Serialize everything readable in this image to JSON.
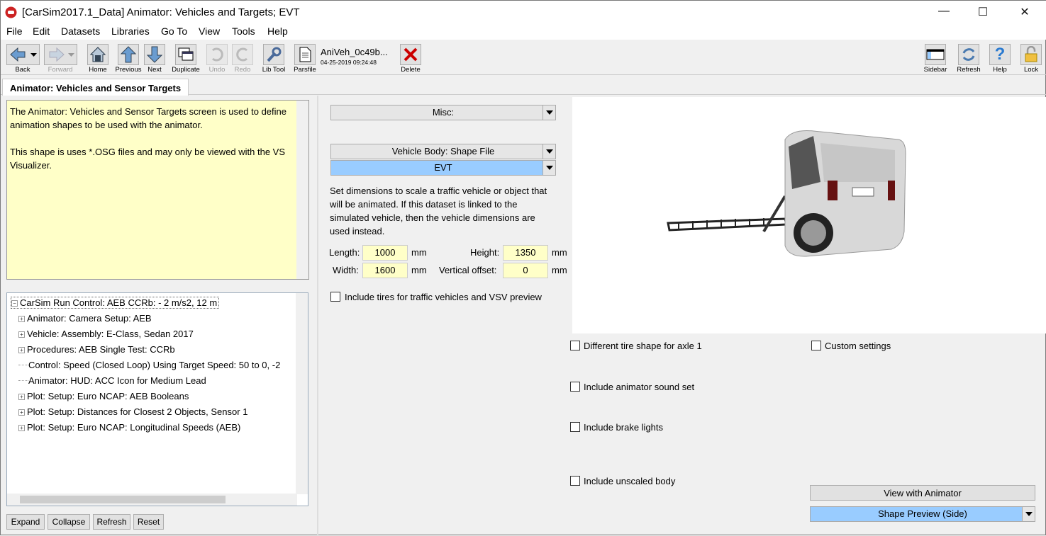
{
  "window": {
    "title": "[CarSim2017.1_Data] Animator: Vehicles and Targets; EVT",
    "minimize": "—",
    "maximize": "☐",
    "close": "✕"
  },
  "menu": [
    "File",
    "Edit",
    "Datasets",
    "Libraries",
    "Go To",
    "View",
    "Tools",
    "Help"
  ],
  "toolbar": {
    "back": "Back",
    "forward": "Forward",
    "home": "Home",
    "previous": "Previous",
    "next": "Next",
    "duplicate": "Duplicate",
    "undo": "Undo",
    "redo": "Redo",
    "libtool": "Lib Tool",
    "parsfile": "Parsfile",
    "dataset_name": "AniVeh_0c49b...",
    "dataset_date": "04-25-2019 09:24:48",
    "delete": "Delete",
    "sidebar": "Sidebar",
    "refresh": "Refresh",
    "help": "Help",
    "lock": "Lock"
  },
  "tab": "Animator: Vehicles and Sensor Targets",
  "notes": {
    "p1": "The Animator: Vehicles and Sensor Targets screen is used to define animation shapes to be used with the animator.",
    "p2": "This shape is uses *.OSG files and may only be viewed with the VS Visualizer."
  },
  "tree": {
    "root": "CarSim Run Control: AEB  CCRb: - 2 m/s2, 12 m",
    "items": [
      {
        "label": "Animator: Camera Setup: AEB",
        "expandable": true
      },
      {
        "label": "Vehicle: Assembly: E-Class, Sedan 2017",
        "expandable": true
      },
      {
        "label": "Procedures: AEB Single Test: CCRb",
        "expandable": true
      },
      {
        "label": "Control: Speed (Closed Loop) Using Target Speed: 50 to 0, -2",
        "expandable": false
      },
      {
        "label": "Animator: HUD: ACC Icon for Medium Lead",
        "expandable": false
      },
      {
        "label": "Plot: Setup: Euro NCAP: AEB Booleans",
        "expandable": true
      },
      {
        "label": "Plot: Setup: Distances for Closest 2 Objects, Sensor 1",
        "expandable": true
      },
      {
        "label": "Plot: Setup: Euro NCAP: Longitudinal Speeds (AEB)",
        "expandable": true
      }
    ]
  },
  "tree_buttons": {
    "expand": "Expand",
    "collapse": "Collapse",
    "refresh": "Refresh",
    "reset": "Reset"
  },
  "form": {
    "misc": "Misc:",
    "shape_label": "Vehicle Body: Shape File",
    "shape_value": "EVT",
    "description": "Set dimensions to scale a traffic vehicle or object that will be animated. If this dataset is linked to the simulated vehicle, then the vehicle dimensions are used instead.",
    "length_label": "Length:",
    "length": "1000",
    "height_label": "Height:",
    "height": "1350",
    "width_label": "Width:",
    "width": "1600",
    "voffset_label": "Vertical offset:",
    "voffset": "0",
    "unit": "mm",
    "tires": "Include tires for traffic vehicles and VSV preview",
    "diff_tire": "Different tire shape for axle 1",
    "custom": "Custom settings",
    "sound": "Include animator sound set",
    "brake": "Include brake lights",
    "unscaled": "Include unscaled body",
    "view_animator": "View with Animator",
    "preview_mode": "Shape Preview (Side)"
  },
  "colors": {
    "notes_bg": "#ffffc8",
    "selected": "#99ccff",
    "delete": "#cc0000"
  }
}
